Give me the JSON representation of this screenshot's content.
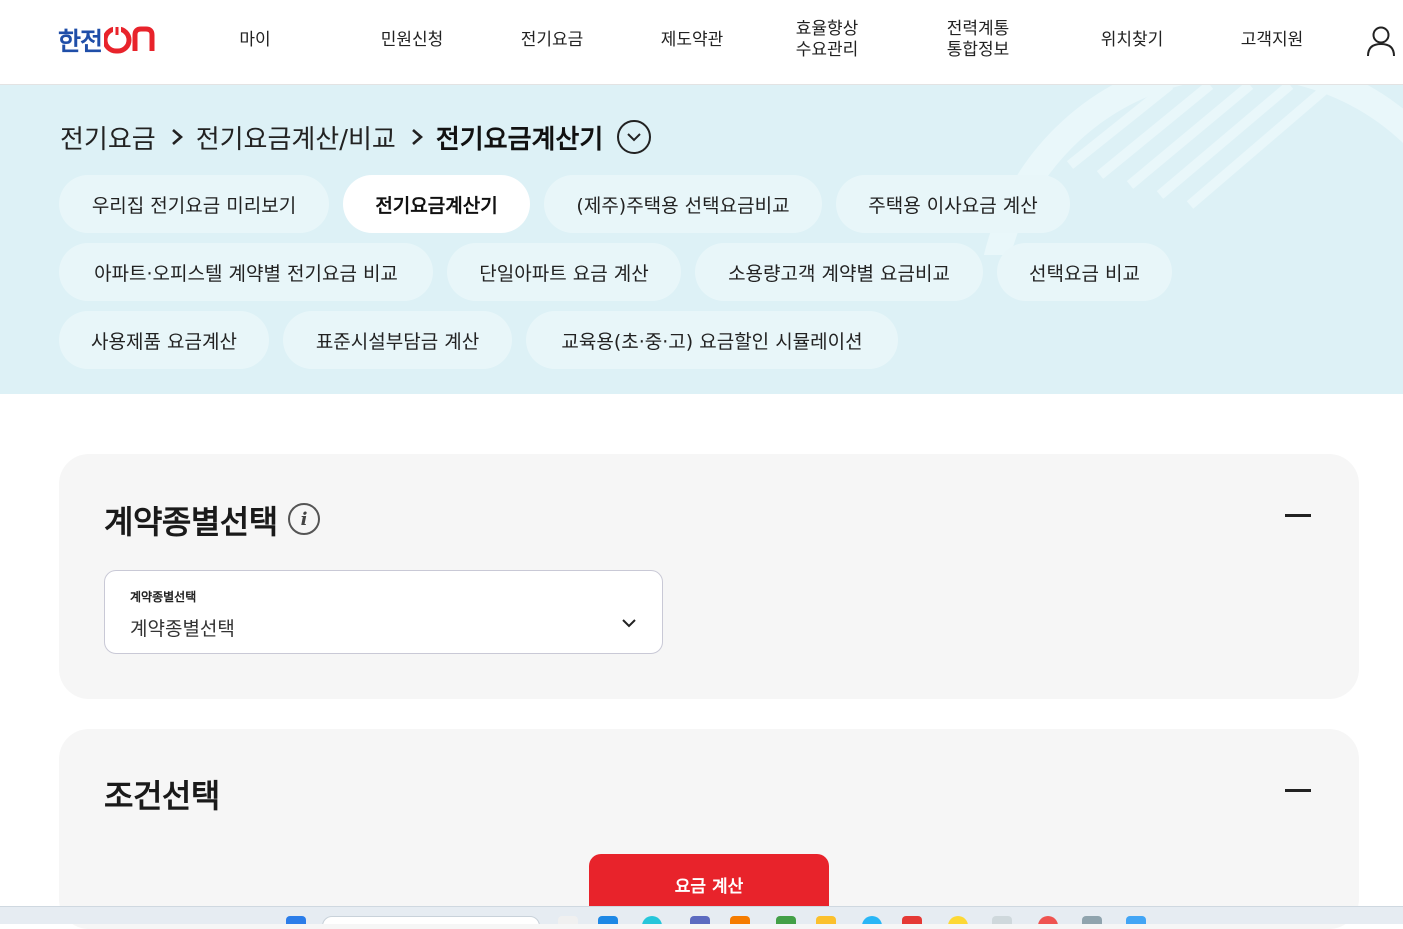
{
  "header": {
    "logo": {
      "brand": "한전",
      "suffix": "ON"
    },
    "nav": [
      {
        "label": "마이"
      },
      {
        "label": "민원신청"
      },
      {
        "label": "전기요금"
      },
      {
        "label": "제도약관"
      },
      {
        "label": "효율향상\n수요관리"
      },
      {
        "label": "전력계통\n통합정보"
      },
      {
        "label": "위치찾기"
      },
      {
        "label": "고객지원"
      }
    ],
    "user_icon": "user-icon"
  },
  "breadcrumb": {
    "items": [
      "전기요금",
      "전기요금계산/비교",
      "전기요금계산기"
    ],
    "toggle_icon": "chevron-down-circle-icon"
  },
  "submenu": {
    "items": [
      {
        "label": "우리집 전기요금 미리보기",
        "active": false
      },
      {
        "label": "전기요금계산기",
        "active": true
      },
      {
        "label": "(제주)주택용 선택요금비교",
        "active": false
      },
      {
        "label": "주택용 이사요금 계산",
        "active": false
      },
      {
        "label": "아파트·오피스텔 계약별 전기요금 비교",
        "active": false
      },
      {
        "label": "단일아파트 요금 계산",
        "active": false
      },
      {
        "label": "소용량고객 계약별 요금비교",
        "active": false
      },
      {
        "label": "선택요금 비교",
        "active": false
      },
      {
        "label": "사용제품 요금계산",
        "active": false
      },
      {
        "label": "표준시설부담금 계산",
        "active": false
      },
      {
        "label": "교육용(초·중·고) 요금할인 시뮬레이션",
        "active": false
      }
    ]
  },
  "contract_panel": {
    "title": "계약종별선택",
    "info_icon": "info-icon",
    "collapse_icon": "minus-icon",
    "select": {
      "label": "계약종별선택",
      "value": "계약종별선택",
      "chevron_icon": "chevron-down-icon"
    }
  },
  "condition_panel": {
    "title": "조건선택",
    "collapse_icon": "minus-icon"
  },
  "calc_button": {
    "label": "요금 계산"
  },
  "colors": {
    "brand_blue": "#1f4ea8",
    "brand_red": "#e8232b",
    "hero_bg": "#ddf1f6",
    "panel_bg": "#f6f6f6"
  }
}
